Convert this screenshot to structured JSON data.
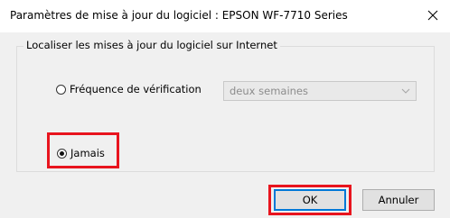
{
  "window": {
    "title": "Paramètres de mise à jour du logiciel : EPSON WF-7710 Series",
    "close_icon": "close-icon"
  },
  "group": {
    "legend": "Localiser les mises à jour du logiciel sur Internet",
    "options": [
      {
        "label": "Fréquence de vérification",
        "selected": false
      },
      {
        "label": "Jamais",
        "selected": true
      }
    ],
    "frequency_select": {
      "value": "deux semaines",
      "enabled": false
    }
  },
  "buttons": {
    "ok_label": "OK",
    "cancel_label": "Annuler"
  },
  "colors": {
    "highlight": "#e8141e",
    "default_button_border": "#0078d7",
    "dialog_background": "#f0f0f0"
  }
}
